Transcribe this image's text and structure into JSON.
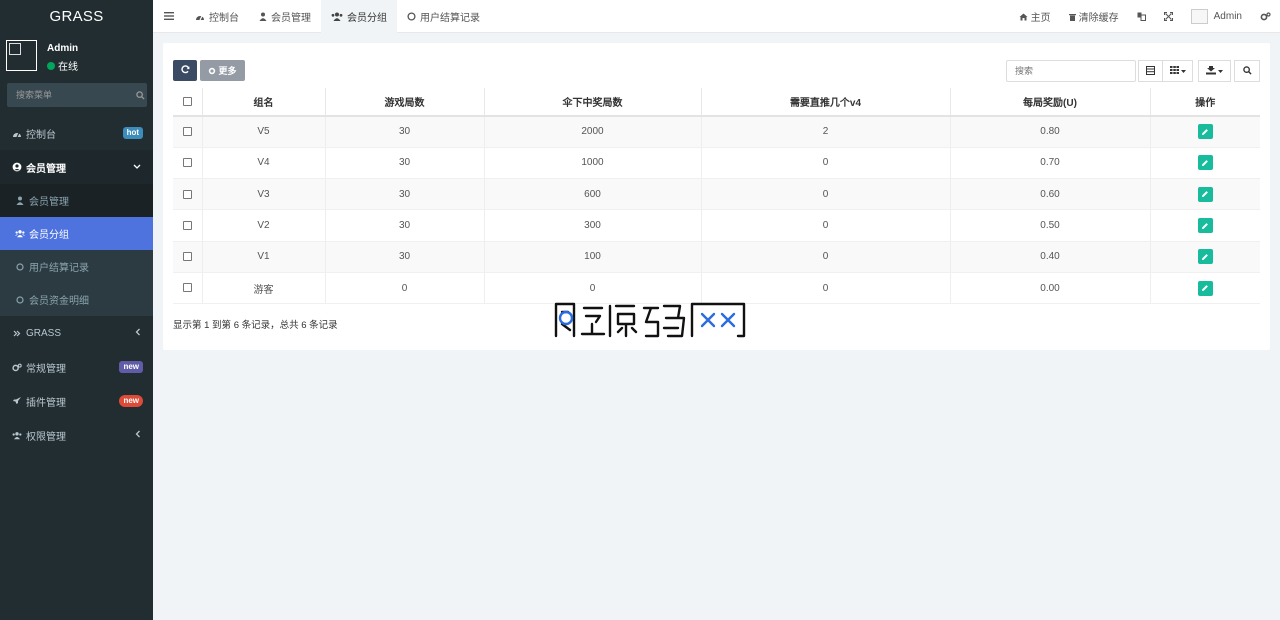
{
  "sidebar": {
    "logo": "GRASS",
    "user": {
      "name": "Admin",
      "status": "在线"
    },
    "search_placeholder": "搜索菜单",
    "items": [
      {
        "label": "控制台",
        "badge": "hot",
        "badge_color": "#3c8dbc",
        "icon": "dashboard-icon"
      },
      {
        "label": "会员管理",
        "icon": "user-circle-icon",
        "open": true,
        "children": [
          {
            "label": "会员管理",
            "icon": "user-icon"
          },
          {
            "label": "会员分组",
            "icon": "users-icon",
            "active": true
          },
          {
            "label": "用户结算记录",
            "icon": "circle-icon"
          },
          {
            "label": "会员资金明细",
            "icon": "circle-icon"
          }
        ]
      },
      {
        "label": "GRASS",
        "icon": "double-chevron-icon"
      },
      {
        "label": "常规管理",
        "badge": "new",
        "badge_color": "#605ca8",
        "icon": "cogs-icon"
      },
      {
        "label": "插件管理",
        "badge": "new",
        "badge_color": "#dd4b39",
        "icon": "rocket-icon"
      },
      {
        "label": "权限管理",
        "icon": "users-icon"
      }
    ]
  },
  "header": {
    "tabs": [
      {
        "label": "控制台",
        "icon": "dashboard-icon"
      },
      {
        "label": "会员管理",
        "icon": "user-icon"
      },
      {
        "label": "会员分组",
        "icon": "users-icon",
        "active": true
      },
      {
        "label": "用户结算记录",
        "icon": "circle-icon"
      }
    ],
    "right": {
      "home": "主页",
      "clear_cache": "清除缓存",
      "user": "Admin"
    }
  },
  "toolbar": {
    "more_label": "更多",
    "search_placeholder": "搜索"
  },
  "table": {
    "columns": [
      "组名",
      "游戏局数",
      "伞下中奖局数",
      "需要直推几个v4",
      "每局奖励(U)",
      "操作"
    ],
    "rows": [
      [
        "V5",
        "30",
        "2000",
        "2",
        "0.80"
      ],
      [
        "V4",
        "30",
        "1000",
        "0",
        "0.70"
      ],
      [
        "V3",
        "30",
        "600",
        "0",
        "0.60"
      ],
      [
        "V2",
        "30",
        "300",
        "0",
        "0.50"
      ],
      [
        "V1",
        "30",
        "100",
        "0",
        "0.40"
      ],
      [
        "游客",
        "0",
        "0",
        "0",
        "0.00"
      ]
    ]
  },
  "pagination_info": "显示第 1 到第 6 条记录，总共 6 条记录",
  "colors": {
    "sidebar_bg": "#222d32",
    "active_menu": "#4e73df",
    "edit_button": "#18bc9c"
  }
}
